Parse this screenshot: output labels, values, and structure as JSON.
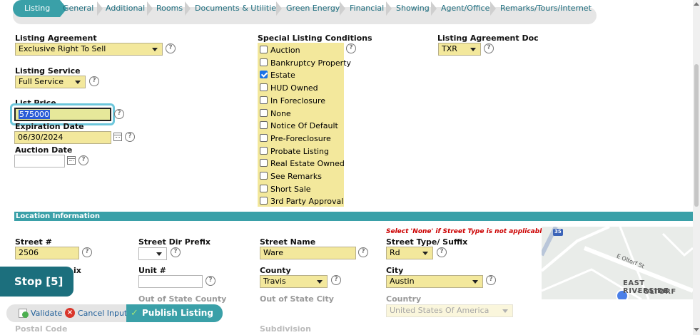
{
  "tabs": [
    {
      "label": "Listing",
      "active": true
    },
    {
      "label": "General"
    },
    {
      "label": "Additional"
    },
    {
      "label": "Rooms"
    },
    {
      "label": "Documents & Utilities"
    },
    {
      "label": "Green Energy"
    },
    {
      "label": "Financial"
    },
    {
      "label": "Showing"
    },
    {
      "label": "Agent/Office"
    },
    {
      "label": "Remarks/Tours/Internet"
    }
  ],
  "listing": {
    "agreement_label": "Listing Agreement",
    "agreement_value": "Exclusive Right To Sell",
    "service_label": "Listing Service",
    "service_value": "Full Service",
    "price_label": "List Price",
    "price_value": "575000",
    "expiration_label": "Expiration Date",
    "expiration_value": "06/30/2024",
    "auction_label": "Auction Date",
    "auction_value": ""
  },
  "special_conditions": {
    "label": "Special Listing Conditions",
    "items": [
      {
        "label": "Auction",
        "checked": false
      },
      {
        "label": "Bankruptcy Property",
        "checked": false
      },
      {
        "label": "Estate",
        "checked": true
      },
      {
        "label": "HUD Owned",
        "checked": false
      },
      {
        "label": "In Foreclosure",
        "checked": false
      },
      {
        "label": "None",
        "checked": false
      },
      {
        "label": "Notice Of Default",
        "checked": false
      },
      {
        "label": "Pre-Foreclosure",
        "checked": false
      },
      {
        "label": "Probate Listing",
        "checked": false
      },
      {
        "label": "Real Estate Owned",
        "checked": false
      },
      {
        "label": "See Remarks",
        "checked": false
      },
      {
        "label": "Short Sale",
        "checked": false
      },
      {
        "label": "3rd Party Approval",
        "checked": false
      }
    ]
  },
  "agreement_doc": {
    "label": "Listing Agreement Doc",
    "value": "TXR"
  },
  "location": {
    "section_title": "Location Information",
    "street_num_label": "Street #",
    "street_num_value": "2506",
    "dir_prefix_label": "Street Dir Prefix",
    "street_name_label": "Street Name",
    "street_name_value": "Ware",
    "street_type_note": "Select 'None' if Street Type is not applicable",
    "street_type_label": "Street Type/ Suffix",
    "street_type_value": "Rd",
    "dir_suffix_partial": "ix",
    "unit_label": "Unit #",
    "county_label": "County",
    "county_value": "Travis",
    "city_label": "City",
    "city_value": "Austin",
    "out_state_county": "Out of State County",
    "out_state_city": "Out of State City",
    "country_label": "Country",
    "country_value": "United States Of America",
    "postal_label": "Postal Code",
    "subdivision_label": "Subdivision"
  },
  "map": {
    "label1": "EAST RIVERSIDE",
    "label2": "- OLTORF",
    "street": "E Oltorf St",
    "highway": "35"
  },
  "stop_label": "Stop [5]",
  "bottom": {
    "validate": "Validate",
    "cancel": "Cancel Input",
    "publish": "Publish Listing"
  },
  "colors": {
    "accent": "#3aa0a8",
    "field": "#f3e89c",
    "note": "#cc0000",
    "stop": "#1c6f7d"
  }
}
